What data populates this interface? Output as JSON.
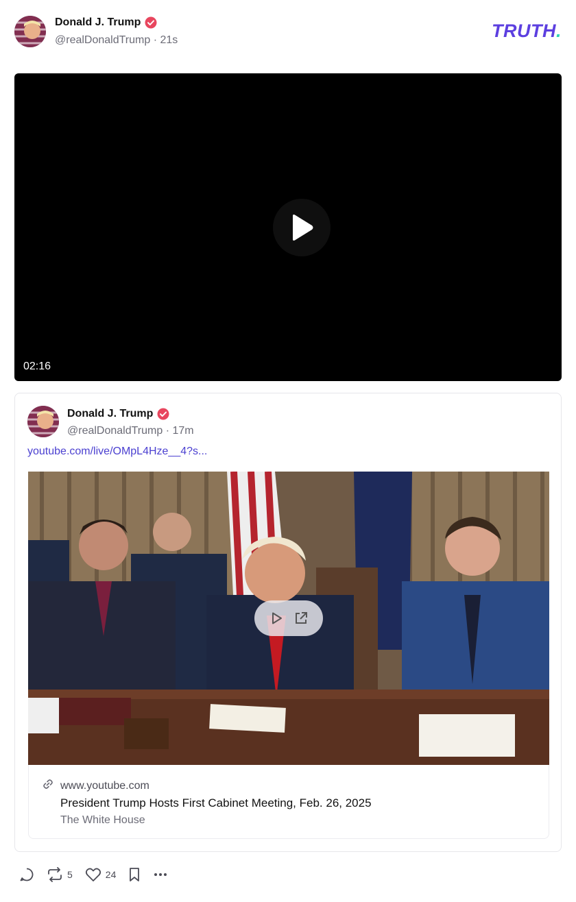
{
  "post": {
    "author": {
      "display_name": "Donald J. Trump",
      "handle": "@realDonaldTrump",
      "time": "· 21s"
    },
    "brand": {
      "text": "TRUTH",
      "dot": "."
    },
    "video": {
      "duration": "02:16"
    }
  },
  "quote": {
    "author": {
      "display_name": "Donald J. Trump",
      "handle": "@realDonaldTrump",
      "time": "· 17m"
    },
    "link_text": "youtube.com/live/OMpL4Hze__4?s...",
    "card": {
      "domain": "www.youtube.com",
      "title": "President Trump Hosts First Cabinet Meeting, Feb. 26, 2025",
      "source": "The White House"
    }
  },
  "actions": {
    "retruth_count": "5",
    "like_count": "24"
  },
  "colors": {
    "brand": "#5c3fe0",
    "brand_dot": "#2fd3b5",
    "verified": "#e8465e",
    "link": "#4a3fd0"
  }
}
